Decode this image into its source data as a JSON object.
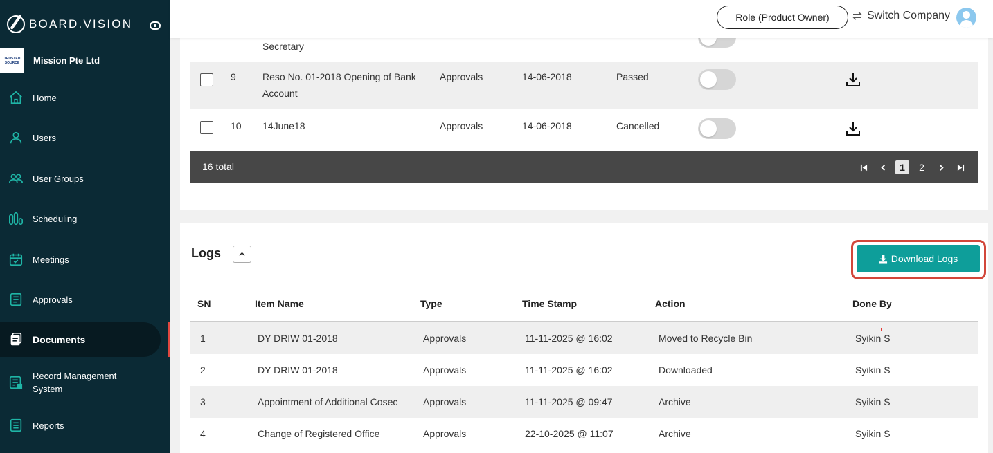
{
  "brand": {
    "name": "BOARD.VISION"
  },
  "company": {
    "name": "Mission Pte Ltd",
    "logo_text": "TRUSTED SOURCE"
  },
  "sidebar": {
    "items": [
      {
        "label": "Home",
        "icon": "home-icon"
      },
      {
        "label": "Users",
        "icon": "user-icon"
      },
      {
        "label": "User Groups",
        "icon": "user-groups-icon"
      },
      {
        "label": "Scheduling",
        "icon": "scheduling-icon"
      },
      {
        "label": "Meetings",
        "icon": "calendar-icon"
      },
      {
        "label": "Approvals",
        "icon": "approvals-icon"
      },
      {
        "label": "Documents",
        "icon": "documents-icon",
        "active": true
      },
      {
        "label": "Record Management System",
        "icon": "record-icon"
      },
      {
        "label": "Reports",
        "icon": "reports-icon"
      }
    ],
    "accent_color": "#1fb5a6",
    "active_marker_color": "#e0473f"
  },
  "header": {
    "role_label": "Role (Product Owner)",
    "switch_label": "Switch Company"
  },
  "approvals": {
    "partial_row_text": "Secretary",
    "rows": [
      {
        "sn": "9",
        "name_line1": "Reso No. 01-2018 Opening of Bank",
        "name_line2": "Account",
        "type": "Approvals",
        "date": "14-06-2018",
        "status": "Passed",
        "toggle": false
      },
      {
        "sn": "10",
        "name_line1": "14June18",
        "name_line2": "",
        "type": "Approvals",
        "date": "14-06-2018",
        "status": "Cancelled",
        "toggle": false
      }
    ],
    "total_label": "16 total",
    "pager": {
      "pages": [
        "1",
        "2"
      ],
      "current": "1"
    }
  },
  "logs": {
    "title": "Logs",
    "download_label": "Download Logs",
    "button_color": "#0e9e9a",
    "columns": {
      "sn": "SN",
      "item_name": "Item Name",
      "type": "Type",
      "time_stamp": "Time Stamp",
      "action": "Action",
      "done_by": "Done By"
    },
    "rows": [
      {
        "sn": "1",
        "item_name": "DY DRIW 01-2018",
        "type": "Approvals",
        "time_stamp": "11-11-2025 @ 16:02",
        "action": "Moved to Recycle Bin",
        "done_by": "Syikin S"
      },
      {
        "sn": "2",
        "item_name": "DY DRIW 01-2018",
        "type": "Approvals",
        "time_stamp": "11-11-2025 @ 16:02",
        "action": "Downloaded",
        "done_by": "Syikin S"
      },
      {
        "sn": "3",
        "item_name": "Appointment of Additional Cosec",
        "type": "Approvals",
        "time_stamp": "11-11-2025 @ 09:47",
        "action": "Archive",
        "done_by": "Syikin S"
      },
      {
        "sn": "4",
        "item_name": "Change of Registered Office",
        "type": "Approvals",
        "time_stamp": "22-10-2025 @ 11:07",
        "action": "Archive",
        "done_by": "Syikin S"
      }
    ]
  }
}
